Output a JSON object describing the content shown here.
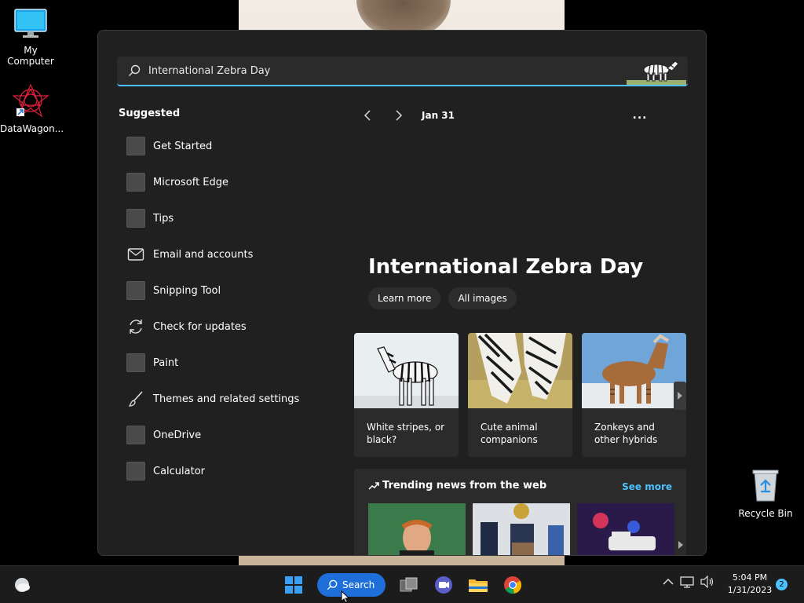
{
  "desktop": {
    "icons": [
      {
        "label": "My Computer",
        "icon": "monitor-icon"
      },
      {
        "label": "DataWagon...",
        "icon": "datawagon-icon"
      },
      {
        "label": "Recycle Bin",
        "icon": "recycle-bin-icon"
      }
    ]
  },
  "search": {
    "query": "International Zebra Day",
    "icon": "search-icon"
  },
  "suggested": {
    "title": "Suggested",
    "items": [
      {
        "label": "Get Started",
        "icon": "app-placeholder-icon"
      },
      {
        "label": "Microsoft Edge",
        "icon": "app-placeholder-icon"
      },
      {
        "label": "Tips",
        "icon": "app-placeholder-icon"
      },
      {
        "label": "Email and accounts",
        "icon": "mail-icon"
      },
      {
        "label": "Snipping Tool",
        "icon": "app-placeholder-icon"
      },
      {
        "label": "Check for updates",
        "icon": "refresh-icon"
      },
      {
        "label": "Paint",
        "icon": "app-placeholder-icon"
      },
      {
        "label": "Themes and related settings",
        "icon": "brush-icon"
      },
      {
        "label": "OneDrive",
        "icon": "app-placeholder-icon"
      },
      {
        "label": "Calculator",
        "icon": "app-placeholder-icon"
      }
    ]
  },
  "highlights": {
    "date": "Jan 31",
    "more": "...",
    "title": "International Zebra Day",
    "buttons": {
      "learn_more": "Learn more",
      "all_images": "All images"
    },
    "cards": [
      {
        "caption": "White stripes, or black?"
      },
      {
        "caption": "Cute animal companions"
      },
      {
        "caption": "Zonkeys and other hybrids"
      }
    ]
  },
  "trending": {
    "title": "Trending news from the web",
    "see_more": "See more"
  },
  "taskbar": {
    "search_label": "Search",
    "time": "5:04 PM",
    "date": "1/31/2023",
    "notifications": "2"
  },
  "colors": {
    "accent": "#4cc2ff",
    "taskbar_search": "#1e6fd9",
    "panel": "#202020"
  }
}
